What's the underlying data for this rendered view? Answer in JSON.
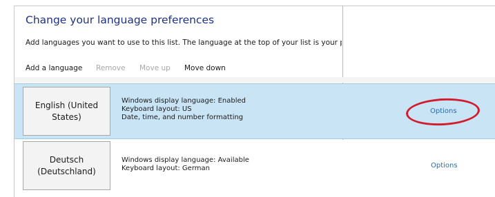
{
  "page": {
    "title": "Change your language preferences",
    "description": "Add languages you want to use to this list. The language at the top of your list is your primary language (the one you want to see and use most often)."
  },
  "toolbar": {
    "add_label": "Add a language",
    "remove_label": "Remove",
    "move_up_label": "Move up",
    "move_down_label": "Move down",
    "remove_enabled": false,
    "move_up_enabled": false,
    "move_down_enabled": true
  },
  "languages": [
    {
      "name": "English (United\nStates)",
      "details": [
        "Windows display language: Enabled",
        "Keyboard layout: US",
        "Date, time, and number formatting"
      ],
      "options_label": "Options",
      "selected": true
    },
    {
      "name": "Deutsch\n(Deutschland)",
      "details": [
        "Windows display language: Available",
        "Keyboard layout: German"
      ],
      "options_label": "Options",
      "selected": false
    }
  ],
  "colors": {
    "title": "#1e3287",
    "selected_row": "#c9e4f5",
    "link": "#2b6cb0",
    "disabled_text": "#a9a9a9",
    "annotation": "#d21c2d"
  }
}
